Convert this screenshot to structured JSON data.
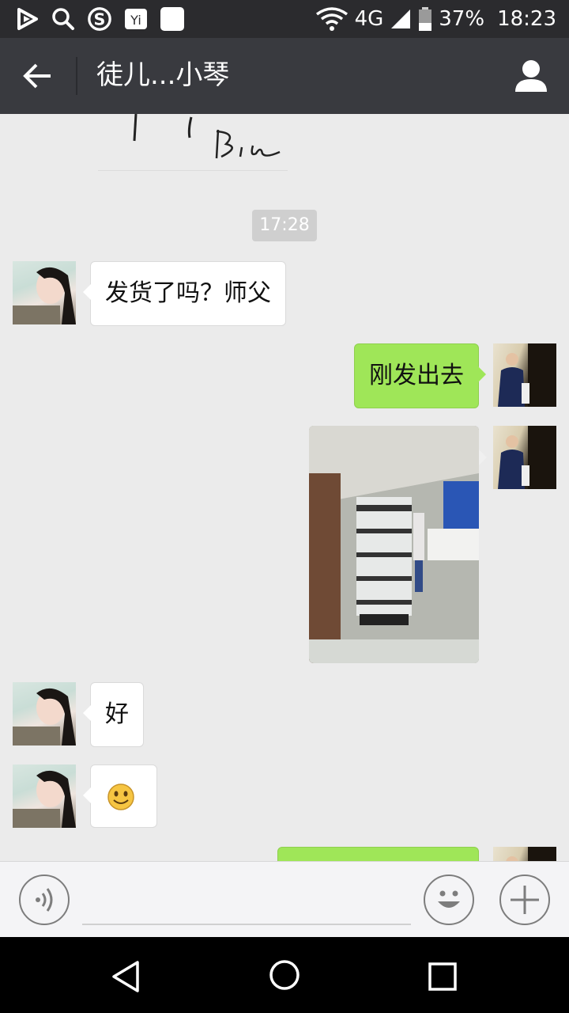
{
  "status_bar": {
    "network": "4G",
    "battery": "37%",
    "time": "18:23",
    "left_icons": [
      "play-store-icon",
      "search-icon",
      "sogou-icon",
      "mail-icon",
      "square-icon"
    ]
  },
  "title_bar": {
    "title": "徒儿...小琴"
  },
  "chat": {
    "timestamp": "17:28",
    "messages": [
      {
        "side": "in",
        "text": "发货了吗？师父"
      },
      {
        "side": "out",
        "text": "刚发出去"
      },
      {
        "side": "out",
        "type": "image"
      },
      {
        "side": "in",
        "text": "好"
      },
      {
        "side": "in",
        "type": "emoji",
        "emoji": "smile-emoji"
      },
      {
        "side": "out",
        "type": "partial",
        "text": ""
      }
    ]
  },
  "colors": {
    "title_bar": "#393a3f",
    "status_bar": "#2b2b2e",
    "chat_bg": "#ebebeb",
    "out_bubble": "#9fe658",
    "in_bubble": "#ffffff"
  }
}
